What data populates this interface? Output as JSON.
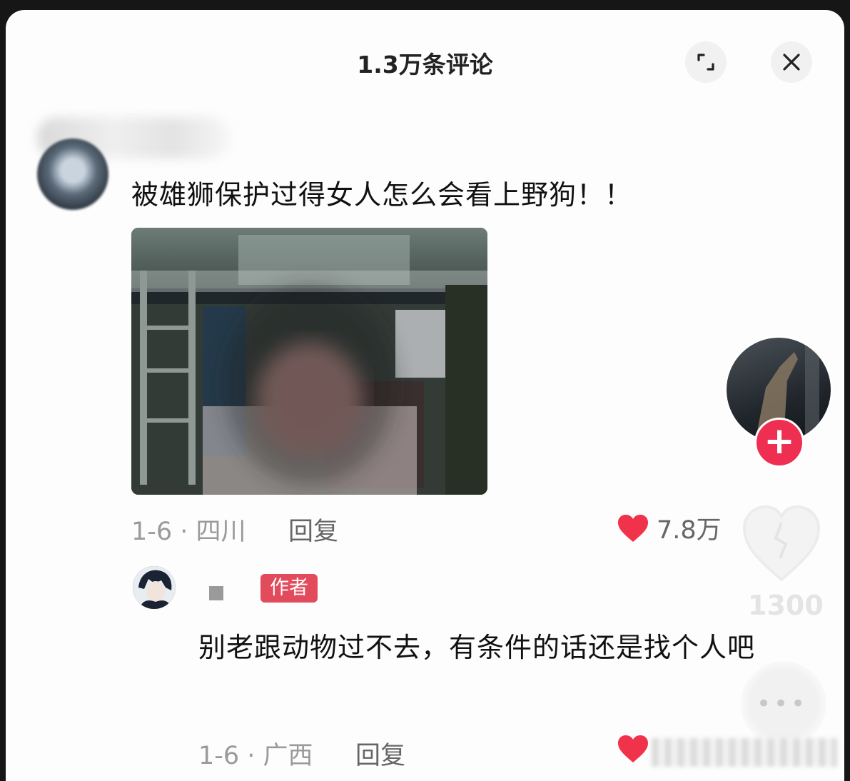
{
  "header": {
    "title": "1.3万条评论"
  },
  "comments": [
    {
      "text": "被雄狮保护过得女人怎么会看上野狗！！",
      "date": "1-6 · 四川",
      "reply_label": "回复",
      "like_count": "7.8万"
    },
    {
      "author_badge": "作者",
      "text": "别老跟动物过不去，有条件的话还是找个人吧",
      "date": "1-6 · 广西",
      "reply_label": "回复"
    }
  ],
  "side": {
    "like_count": "1300"
  },
  "colors": {
    "accent_red": "#ee2f52",
    "heart_red": "#f0324a",
    "badge_red": "#e24b5b"
  },
  "icons": [
    "expand-icon",
    "close-icon",
    "heart-icon",
    "plus-icon",
    "more-icon"
  ]
}
